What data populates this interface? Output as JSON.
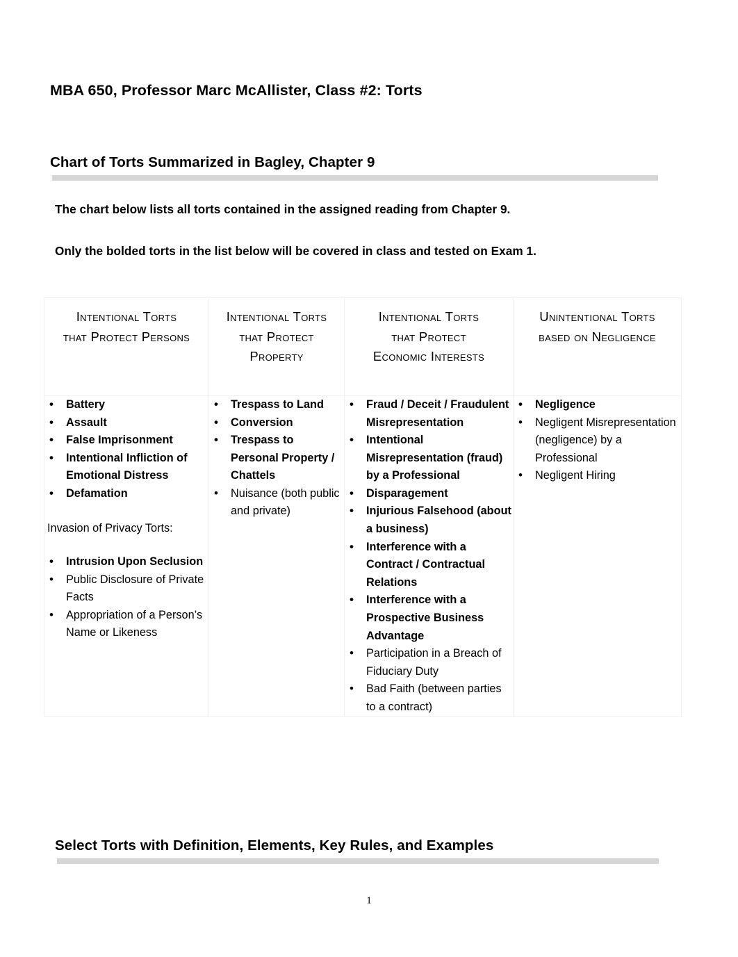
{
  "document": {
    "title": "MBA 650, Professor Marc McAllister, Class #2:  Torts",
    "page_number": "1"
  },
  "section_headings": {
    "chart_heading": "Chart of Torts Summarized in Bagley, Chapter 9",
    "select_torts_heading": "Select Torts with Definition, Elements, Key Rules, and Examples"
  },
  "intro": {
    "line1": "The chart below lists all torts contained in the assigned reading from Chapter 9.",
    "line2": "Only the bolded torts in the list below will be covered in class and tested on Exam 1."
  },
  "table": {
    "headers": [
      "Intentional Torts that Protect Persons",
      "Intentional Torts that Protect Property",
      "Intentional Torts that Protect Economic Interests",
      "Unintentional Torts based on Negligence"
    ],
    "header_lines": [
      [
        "Intentional Torts",
        "that Protect Persons"
      ],
      [
        "Intentional Torts",
        "that Protect",
        "Property"
      ],
      [
        "Intentional Torts",
        "that Protect",
        "Economic Interests"
      ],
      [
        "Unintentional Torts",
        "based on Negligence"
      ]
    ],
    "columns": [
      {
        "items": [
          {
            "text": "Battery",
            "bold": true
          },
          {
            "text": "Assault",
            "bold": true
          },
          {
            "text": "False Imprisonment",
            "bold": true
          },
          {
            "text": "Intentional Infliction of Emotional Distress",
            "bold": true
          },
          {
            "text": "Defamation",
            "bold": true
          }
        ],
        "subhead": "Invasion of Privacy Torts:",
        "items2": [
          {
            "text": "Intrusion Upon Seclusion",
            "bold": true
          },
          {
            "text": "Public Disclosure of Private Facts",
            "bold": false
          },
          {
            "text": "Appropriation of a Person’s Name or Likeness",
            "bold": false
          }
        ]
      },
      {
        "items": [
          {
            "text": "Trespass to Land",
            "bold": true
          },
          {
            "text": "Conversion",
            "bold": true
          },
          {
            "text": "Trespass to Personal Property / Chattels",
            "bold": true
          },
          {
            "text": "Nuisance (both public and private)",
            "bold": false
          }
        ]
      },
      {
        "items": [
          {
            "text": "Fraud / Deceit / Fraudulent Misrepresentation",
            "bold": true
          },
          {
            "text": "Intentional Misrepresentation (fraud) by a Professional",
            "bold": true
          },
          {
            "text": "Disparagement",
            "bold": true
          },
          {
            "text": "Injurious Falsehood (about a business)",
            "bold": true
          },
          {
            "text": "Interference with a Contract / Contractual Relations",
            "bold": true
          },
          {
            "text": "Interference with a Prospective Business Advantage",
            "bold": true
          },
          {
            "text": "Participation in a Breach of Fiduciary Duty",
            "bold": false
          },
          {
            "text": "Bad Faith (between parties to a contract)",
            "bold": false
          }
        ]
      },
      {
        "items": [
          {
            "text": "Negligence",
            "bold": true
          },
          {
            "text": "Negligent Misrepresentation (negligence) by a Professional",
            "bold": false
          },
          {
            "text": "Negligent Hiring",
            "bold": false
          }
        ]
      }
    ]
  }
}
